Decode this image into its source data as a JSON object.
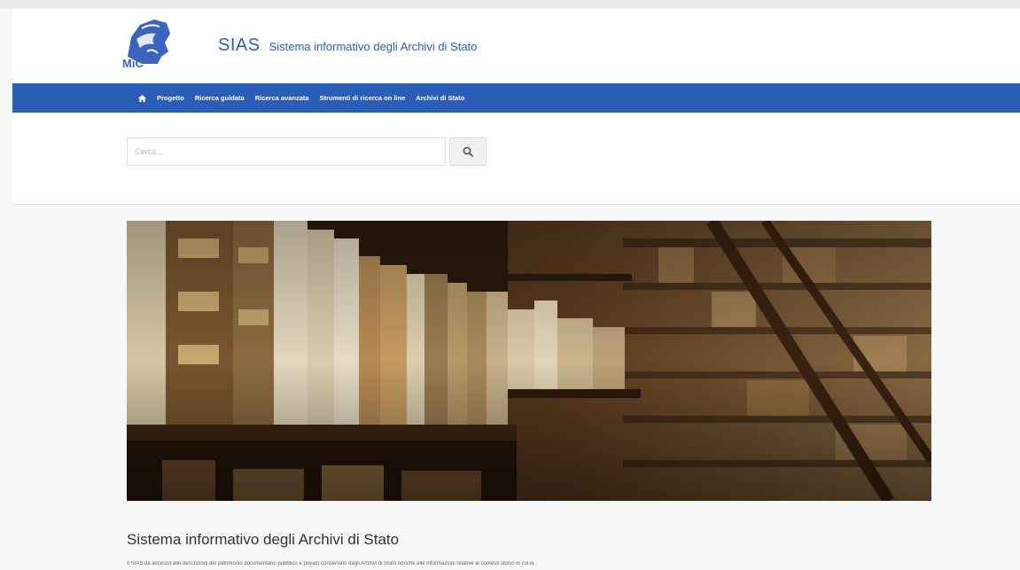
{
  "header": {
    "logo_text": "MiC",
    "brand_name": "SIAS",
    "brand_subtitle": "Sistema informativo degli Archivi di Stato"
  },
  "nav": {
    "home_icon": "home-icon",
    "items": [
      {
        "label": "Progetto"
      },
      {
        "label": "Ricerca guidata"
      },
      {
        "label": "Ricerca avanzata"
      },
      {
        "label": "Strumenti di ricerca on line"
      },
      {
        "label": "Archivi di Stato"
      }
    ]
  },
  "search": {
    "placeholder": "Cerca...",
    "button_icon": "search-icon"
  },
  "main": {
    "title": "Sistema informativo degli Archivi di Stato",
    "intro": "Il SIAS dà accesso alle descrizioni del patrimonio documentario pubblico e privato conservato dagli Archivi di Stato nonché alle informazioni relative ai contesti storici in cui la"
  },
  "colors": {
    "nav_bg": "#2b5fb7",
    "brand": "#2b5fb7"
  }
}
